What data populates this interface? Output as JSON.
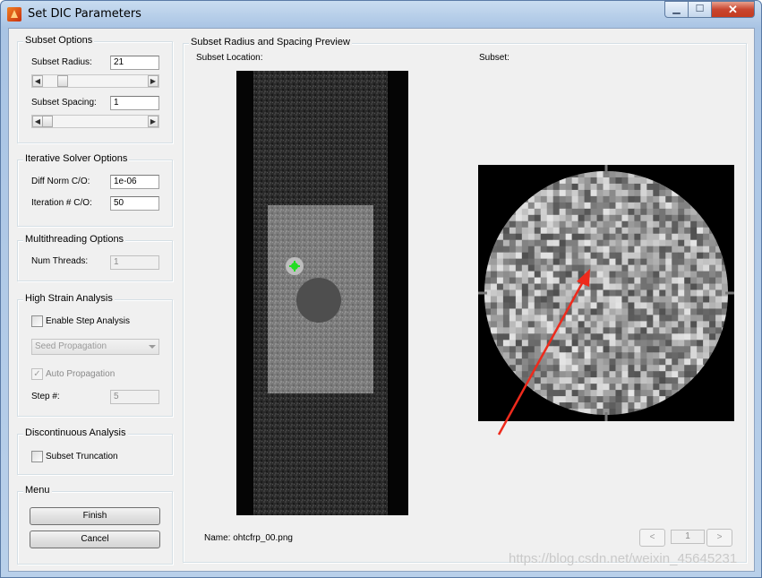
{
  "window": {
    "title": "Set DIC Parameters",
    "minimize_icon": "minimize-icon",
    "maximize_icon": "maximize-icon",
    "close_icon": "close-icon"
  },
  "subset_options": {
    "title": "Subset Options",
    "radius_label": "Subset Radius:",
    "radius_value": "21",
    "spacing_label": "Subset Spacing:",
    "spacing_value": "1"
  },
  "solver": {
    "title": "Iterative Solver Options",
    "diffnorm_label": "Diff Norm C/O:",
    "diffnorm_value": "1e-06",
    "iter_label": "Iteration # C/O:",
    "iter_value": "50"
  },
  "threading": {
    "title": "Multithreading Options",
    "threads_label": "Num Threads:",
    "threads_value": "1"
  },
  "high_strain": {
    "title": "High Strain Analysis",
    "enable_label": "Enable Step Analysis",
    "seed_value": "Seed Propagation",
    "auto_label": "Auto Propagation",
    "step_label": "Step #:",
    "step_value": "5"
  },
  "discontinuous": {
    "title": "Discontinuous Analysis",
    "truncation_label": "Subset Truncation"
  },
  "menu": {
    "title": "Menu",
    "finish": "Finish",
    "cancel": "Cancel"
  },
  "preview": {
    "title": "Subset Radius and Spacing Preview",
    "location_label": "Subset Location:",
    "subset_label": "Subset:",
    "name_text": "Name: ohtcfrp_00.png",
    "prev": "<",
    "page": "1",
    "next": ">"
  },
  "watermark": "https://blog.csdn.net/weixin_45645231",
  "colors": {
    "arrow": "#ee2a1c",
    "marker": "#22dd22"
  }
}
